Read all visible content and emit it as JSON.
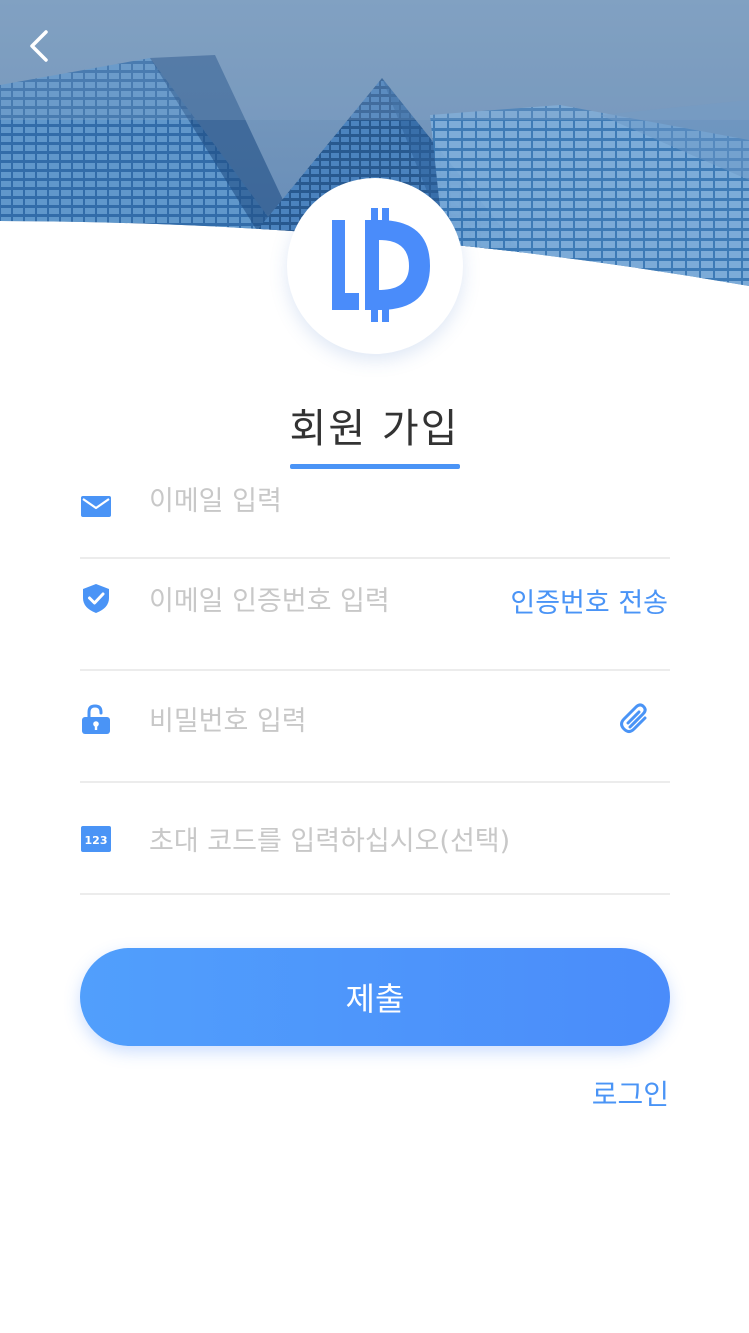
{
  "header": {
    "back_icon": "chevron-left-icon",
    "logo_icon": "bitcoin-logo-icon"
  },
  "title": "회원 가입",
  "colors": {
    "accent": "#4a94f6",
    "button_start": "#519ffc",
    "button_end": "#4a8cfa",
    "placeholder": "#c8c8c8",
    "divider": "#ececec"
  },
  "form": {
    "email": {
      "icon": "envelope-icon",
      "placeholder": "이메일 입력"
    },
    "email_code": {
      "icon": "shield-check-icon",
      "placeholder": "이메일 인증번호 입력",
      "send_label": "인증번호 전송"
    },
    "password": {
      "icon": "unlocked-padlock-icon",
      "placeholder": "비밀번호 입력",
      "action_icon": "paperclip-icon"
    },
    "invite_code": {
      "icon": "number-123-icon",
      "placeholder": "초대 코드를 입력하십시오(선택)"
    }
  },
  "submit_label": "제출",
  "login_label": "로그인"
}
